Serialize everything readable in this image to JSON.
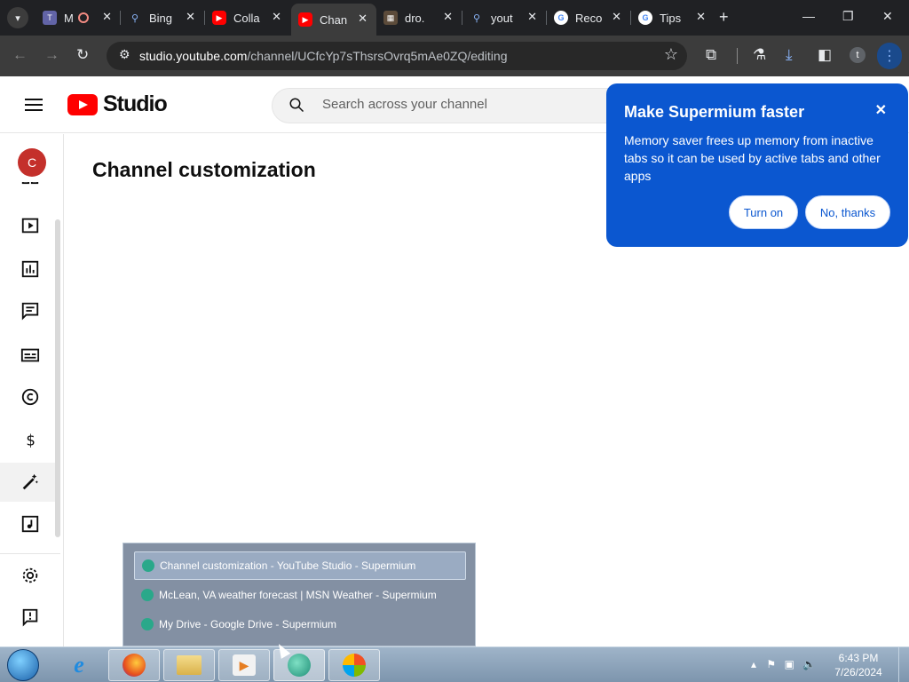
{
  "browser": {
    "tabs": [
      {
        "title": "M",
        "favicon_color": "#6264a7",
        "icon": "teams-icon"
      },
      {
        "title": "Bing",
        "favicon_color": "#202124",
        "icon": "search-icon"
      },
      {
        "title": "Colla",
        "favicon_color": "#ff0000",
        "icon": "youtube-icon"
      },
      {
        "title": "Chan",
        "favicon_color": "#ff0000",
        "icon": "youtube-icon",
        "active": true
      },
      {
        "title": "dro.",
        "favicon_color": "#5c4b3a",
        "icon": "image-icon"
      },
      {
        "title": "yout",
        "favicon_color": "#202124",
        "icon": "search-icon"
      },
      {
        "title": "Reco",
        "favicon_color": "#ffffff",
        "icon": "google-icon"
      },
      {
        "title": "Tips",
        "favicon_color": "#ffffff",
        "icon": "google-icon"
      }
    ],
    "new_tab_label": "+",
    "url": {
      "host": "studio.youtube.com",
      "path": "/channel/UCfcYp7sThsrsOvrq5mAe0ZQ/editing"
    },
    "profile_initial": "t"
  },
  "studio": {
    "brand_word": "Studio",
    "search_placeholder": "Search across your channel",
    "channel_initial": "C",
    "page_title": "Channel customization"
  },
  "promo": {
    "title": "Make Supermium faster",
    "body": "Memory saver frees up memory from inactive tabs so it can be used by active tabs and other apps",
    "turn_on": "Turn on",
    "no_thanks": "No, thanks",
    "close": "✕"
  },
  "taskbar": {
    "window_list": [
      "Channel customization - YouTube Studio - Supermium",
      "McLean, VA weather forecast | MSN Weather - Supermium",
      "My Drive - Google Drive - Supermium"
    ],
    "time": "6:43 PM",
    "date": "7/26/2024"
  },
  "colors": {
    "promo_bg": "#0b57d0",
    "youtube_red": "#ff0000",
    "tabstrip_bg": "#202124",
    "toolbar_bg": "#3c3c3c"
  }
}
